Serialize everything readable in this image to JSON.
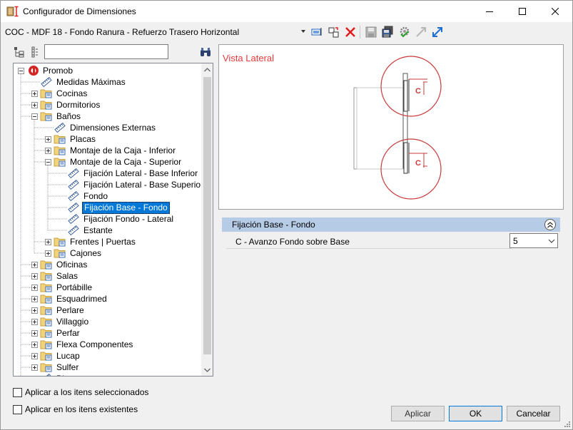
{
  "window": {
    "title": "Configurador de Dimensiones",
    "icon": "ruler-app-icon"
  },
  "toolbar": {
    "config_name": "COC - MDF 18 - Fondo Ranura - Refuerzo Trasero Horizontal",
    "icons": [
      "select-frame-icon",
      "new-item-icon",
      "delete-icon",
      "save-icon",
      "save-all-icon",
      "settings-check-icon",
      "collapse-icon",
      "expand-icon"
    ]
  },
  "search": {
    "value": "",
    "placeholder": ""
  },
  "tree": {
    "nodes": [
      {
        "label": "Promob",
        "level": 0,
        "type": "root",
        "expander": "minus"
      },
      {
        "label": "Medidas Máximas",
        "level": 1,
        "type": "dimension",
        "expander": "none"
      },
      {
        "label": "Cocinas",
        "level": 1,
        "type": "folder",
        "expander": "plus"
      },
      {
        "label": "Dormitorios",
        "level": 1,
        "type": "folder",
        "expander": "plus"
      },
      {
        "label": "Baños",
        "level": 1,
        "type": "folder",
        "expander": "minus"
      },
      {
        "label": "Dimensiones Externas",
        "level": 2,
        "type": "dimension",
        "expander": "none"
      },
      {
        "label": "Placas",
        "level": 2,
        "type": "folder",
        "expander": "plus"
      },
      {
        "label": "Montaje de la Caja - Inferior",
        "level": 2,
        "type": "folder",
        "expander": "plus"
      },
      {
        "label": "Montaje de la Caja - Superior",
        "level": 2,
        "type": "folder",
        "expander": "minus"
      },
      {
        "label": "Fijación Lateral - Base Inferior",
        "level": 3,
        "type": "dimension",
        "expander": "none"
      },
      {
        "label": "Fijación Lateral - Base Superior",
        "level": 3,
        "type": "dimension",
        "expander": "none"
      },
      {
        "label": "Fondo",
        "level": 3,
        "type": "dimension",
        "expander": "none"
      },
      {
        "label": "Fijación Base - Fondo",
        "level": 3,
        "type": "dimension",
        "expander": "none",
        "selected": true
      },
      {
        "label": "Fijación Fondo - Lateral",
        "level": 3,
        "type": "dimension",
        "expander": "none"
      },
      {
        "label": "Estante",
        "level": 3,
        "type": "dimension",
        "expander": "none"
      },
      {
        "label": "Frentes | Puertas",
        "level": 2,
        "type": "folder",
        "expander": "plus"
      },
      {
        "label": "Cajones",
        "level": 2,
        "type": "folder",
        "expander": "plus"
      },
      {
        "label": "Oficinas",
        "level": 1,
        "type": "folder",
        "expander": "plus"
      },
      {
        "label": "Salas",
        "level": 1,
        "type": "folder",
        "expander": "plus"
      },
      {
        "label": "Portábille",
        "level": 1,
        "type": "folder",
        "expander": "plus"
      },
      {
        "label": "Esquadrimed",
        "level": 1,
        "type": "folder",
        "expander": "plus"
      },
      {
        "label": "Perlare",
        "level": 1,
        "type": "folder",
        "expander": "plus"
      },
      {
        "label": "Villaggio",
        "level": 1,
        "type": "folder",
        "expander": "plus"
      },
      {
        "label": "Perfar",
        "level": 1,
        "type": "folder",
        "expander": "plus"
      },
      {
        "label": "Flexa Componentes",
        "level": 1,
        "type": "folder",
        "expander": "plus"
      },
      {
        "label": "Lucap",
        "level": 1,
        "type": "folder",
        "expander": "plus"
      },
      {
        "label": "Sulfer",
        "level": 1,
        "type": "folder",
        "expander": "plus"
      },
      {
        "label": "Pl...",
        "level": 1,
        "type": "dimension",
        "expander": "none"
      }
    ]
  },
  "preview": {
    "title": "Vista Lateral",
    "callout_label": "C",
    "accent_color": "#e33a3a"
  },
  "properties": {
    "section_title": "Fijación Base - Fondo",
    "rows": [
      {
        "label": "C - Avanzo Fondo sobre Base",
        "value": "5"
      }
    ]
  },
  "options": {
    "apply_selected": "Aplicar a los itens seleccionados",
    "apply_existing": "Aplicar en los itens existentes"
  },
  "buttons": {
    "apply": "Aplicar",
    "ok": "OK",
    "cancel": "Cancelar"
  }
}
